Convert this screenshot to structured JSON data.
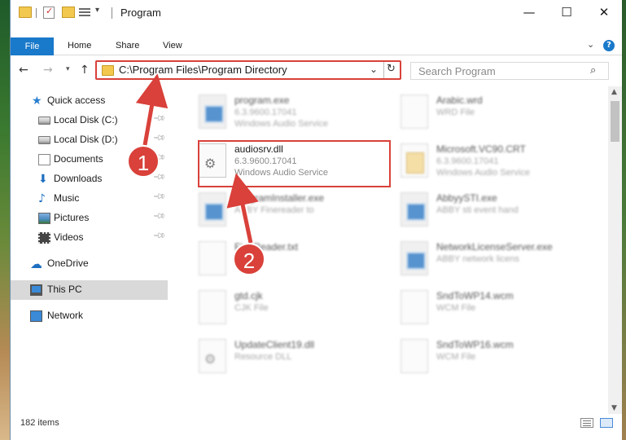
{
  "window": {
    "title": "Program",
    "controls": {
      "minimize": "—",
      "maximize": "☐",
      "close": "✕"
    }
  },
  "ribbon": {
    "tabs": [
      "File",
      "Home",
      "Share",
      "View"
    ],
    "help": "?"
  },
  "navigation": {
    "address": "C:\\Program Files\\Program Directory",
    "search_placeholder": "Search Program"
  },
  "sidebar": {
    "items": [
      {
        "label": "Quick access",
        "icon": "star-icon"
      },
      {
        "label": "Local Disk (C:)",
        "icon": "drive-icon",
        "pinned": true
      },
      {
        "label": "Local Disk (D:)",
        "icon": "drive-icon",
        "pinned": true
      },
      {
        "label": "Documents",
        "icon": "documents-icon",
        "pinned": true
      },
      {
        "label": "Downloads",
        "icon": "download-icon",
        "pinned": true
      },
      {
        "label": "Music",
        "icon": "music-icon",
        "pinned": true
      },
      {
        "label": "Pictures",
        "icon": "pictures-icon",
        "pinned": true
      },
      {
        "label": "Videos",
        "icon": "videos-icon",
        "pinned": true
      },
      {
        "label": "OneDrive",
        "icon": "cloud-icon"
      },
      {
        "label": "This PC",
        "icon": "computer-icon",
        "selected": true
      },
      {
        "label": "Network",
        "icon": "network-icon"
      }
    ]
  },
  "files": [
    {
      "name": "program.exe",
      "line2": "6.3.9600.17041",
      "line3": "Windows Audio Service",
      "icon": "exe-icon"
    },
    {
      "name": "Arabic.wrd",
      "line2": "WRD File",
      "line3": "",
      "icon": "document-icon"
    },
    {
      "name": "audiosrv.dll",
      "line2": "6.3.9600.17041",
      "line3": "Windows Audio Service",
      "icon": "gear-dll-icon"
    },
    {
      "name": "Microsoft.VC90.CRT",
      "line2": "6.3.9600.17041",
      "line3": "Windows Audio Service",
      "icon": "cab-icon"
    },
    {
      "name": "ProgramInstaller.exe",
      "line2": "ABBY Finereader to",
      "line3": "",
      "icon": "exe-icon"
    },
    {
      "name": "AbbyySTI.exe",
      "line2": "ABBY sti event hand",
      "line3": "",
      "icon": "exe-icon"
    },
    {
      "name": "FineReader.txt",
      "line2": "",
      "line3": "",
      "icon": "document-icon"
    },
    {
      "name": "NetworkLicenseServer.exe",
      "line2": "ABBY network licens",
      "line3": "",
      "icon": "exe-icon"
    },
    {
      "name": "gtd.cjk",
      "line2": "CJK File",
      "line3": "",
      "icon": "document-icon"
    },
    {
      "name": "SndToWP14.wcm",
      "line2": "WCM File",
      "line3": "",
      "icon": "document-icon"
    },
    {
      "name": "UpdateClient19.dll",
      "line2": "Resource DLL",
      "line3": "",
      "icon": "gear-dll-icon"
    },
    {
      "name": "SndToWP16.wcm",
      "line2": "WCM File",
      "line3": "",
      "icon": "document-icon"
    }
  ],
  "status": {
    "items_count": "182 items"
  },
  "annotations": {
    "step1": "1",
    "step2": "2",
    "color": "#d9413a"
  },
  "colors": {
    "accent": "#1979ca",
    "highlight": "#d9413a",
    "selected": "#d9d9d9"
  }
}
